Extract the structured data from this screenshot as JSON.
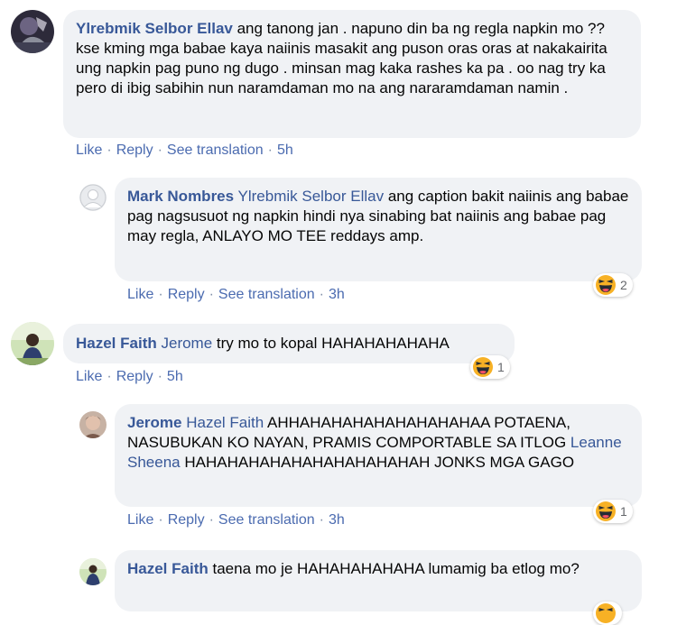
{
  "comments": [
    {
      "name": "Ylrebmik Selbor Ellav",
      "text": "ang tanong jan . napuno din ba ng regla napkin mo ?? kse kming mga babae kaya naiinis masakit ang puson oras oras at nakakairita ung napkin pag puno ng dugo . minsan mag kaka rashes ka pa . oo nag try ka pero di ibig sabihin nun naramdaman mo na ang nararamdaman namin .",
      "actions": {
        "like": "Like",
        "reply": "Reply",
        "translate": "See translation",
        "time": "5h"
      }
    },
    {
      "name": "Mark Nombres",
      "tag": "Ylrebmik Selbor Ellav",
      "text": "ang caption bakit naiinis ang babae pag nagsusuot ng napkin hindi nya sinabing bat naiinis ang babae pag may regla, ANLAYO MO TEE reddays amp.",
      "actions": {
        "like": "Like",
        "reply": "Reply",
        "translate": "See translation",
        "time": "3h"
      },
      "reaction_count": "2"
    },
    {
      "name": "Hazel Faith",
      "tag": "Jerome",
      "text": "try mo to kopal HAHAHAHAHAHA",
      "actions": {
        "like": "Like",
        "reply": "Reply",
        "time": "5h"
      },
      "reaction_count": "1"
    },
    {
      "name": "Jerome",
      "tag": "Hazel Faith",
      "text": "AHHAHAHAHAHAHAHAHAHAA POTAENA, NASUBUKAN KO NAYAN, PRAMIS COMPORTABLE SA ITLOG",
      "tag2": "Leanne Sheena",
      "text2": "HAHAHAHAHAHAHAHAHAHAHAH JONKS MGA GAGO",
      "actions": {
        "like": "Like",
        "reply": "Reply",
        "translate": "See translation",
        "time": "3h"
      },
      "reaction_count": "1"
    },
    {
      "name": "Hazel Faith",
      "text": "taena mo je HAHAHAHAHAHA lumamig ba etlog mo?"
    }
  ]
}
